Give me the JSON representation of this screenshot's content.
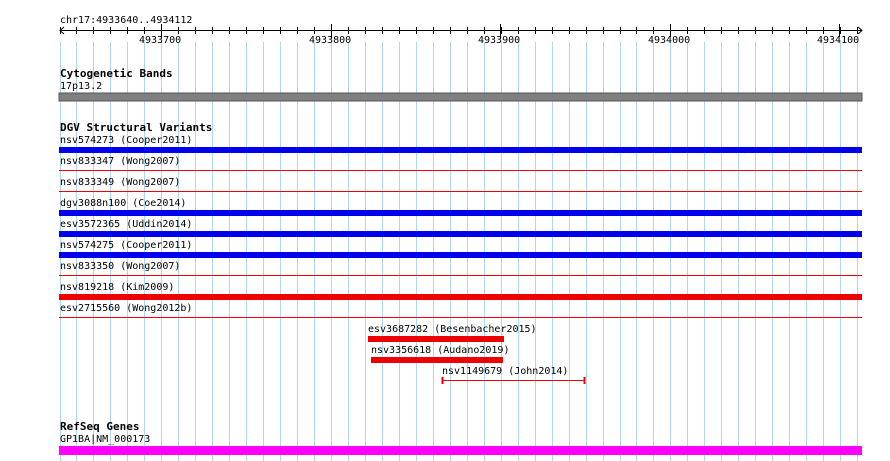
{
  "ruler": {
    "region": "chr17:4933640..4934112",
    "ticks": [
      "4933700",
      "4933800",
      "4933900",
      "4934000",
      "4934100"
    ]
  },
  "tracks": {
    "cytobands": {
      "title": "Cytogenetic Bands",
      "band_label": "17p13.2"
    },
    "dgv": {
      "title": "DGV Structural Variants",
      "variants": [
        {
          "label": "nsv574273 (Cooper2011)",
          "color": "#0000ee"
        },
        {
          "label": "nsv833347 (Wong2007)",
          "color": "#ee0000"
        },
        {
          "label": "nsv833349 (Wong2007)",
          "color": "#ee0000"
        },
        {
          "label": "dgv3088n100 (Coe2014)",
          "color": "#0000ee"
        },
        {
          "label": "esv3572365 (Uddin2014)",
          "color": "#0000ee"
        },
        {
          "label": "nsv574275 (Cooper2011)",
          "color": "#0000ee"
        },
        {
          "label": "nsv833350 (Wong2007)",
          "color": "#ee0000"
        },
        {
          "label": "nsv819218 (Kim2009)",
          "color": "#ee0000"
        },
        {
          "label": "esv2715560 (Wong2012b)",
          "color": "#ee0000"
        },
        {
          "label": "esv3687282 (Besenbacher2015)",
          "color": "#ee0000"
        },
        {
          "label": "nsv3356618 (Audano2019)",
          "color": "#ee0000"
        },
        {
          "label": "nsv1149679 (John2014)",
          "color": "#ee0000"
        }
      ]
    },
    "refseq": {
      "title": "RefSeq Genes",
      "gene_label": "GP1BA|NM_000173",
      "color": "#ff00ff"
    }
  },
  "colors": {
    "grid": "#add8e6",
    "band": "#808080"
  }
}
